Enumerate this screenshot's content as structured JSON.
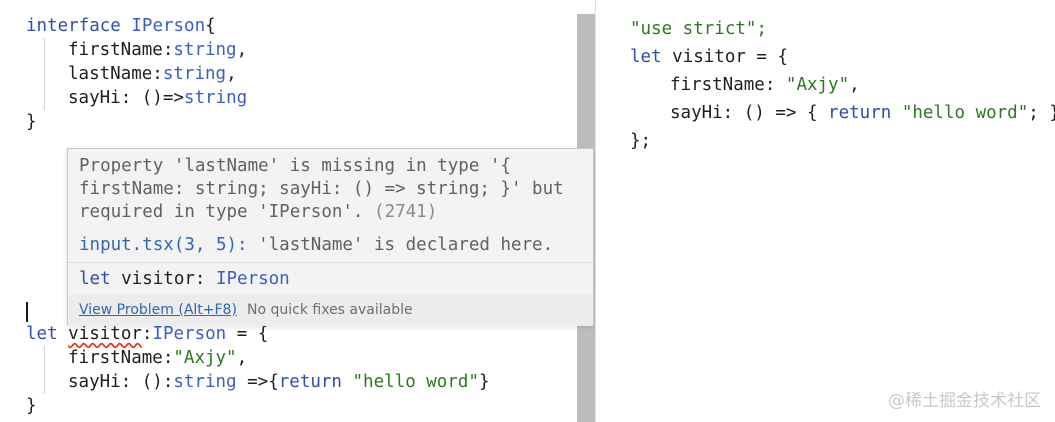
{
  "editor": {
    "interface_block": {
      "kw_interface": "interface",
      "name": "IPerson",
      "open_brace": "{",
      "prop1_name": "firstName",
      "prop1_colon": ":",
      "prop1_type": "string",
      "prop1_comma": ",",
      "prop2_name": "lastName",
      "prop2_colon": ":",
      "prop2_type": "string",
      "prop2_comma": ",",
      "prop3_name": "sayHi",
      "prop3_colon": ": ",
      "prop3_sig": "()=>",
      "prop3_type": "string",
      "close_brace": "}"
    },
    "visitor_block": {
      "kw_let": "let",
      "var_name": "visitor",
      "colon": ":",
      "type_name": "IPerson",
      "assign": " = {",
      "prop1_name": "firstName",
      "prop1_colon": ":",
      "prop1_value": "\"Axjy\"",
      "prop1_comma": ",",
      "prop2_name": "sayHi",
      "prop2_colon": ": ",
      "prop2_paren": "():",
      "prop2_type": "string",
      "prop2_arrow": " =>{",
      "prop2_return": "return",
      "prop2_string": "\"hello word\"",
      "prop2_close": "}",
      "close_brace": "}"
    }
  },
  "hover": {
    "message_line1": "Property 'lastName' is missing in type '{",
    "message_line2": "firstName: string; sayHi: () => string; }' but",
    "message_line3": "required in type 'IPerson'.",
    "error_code": "(2741)",
    "related_link": "input.tsx(3, 5):",
    "related_text": " 'lastName' is declared here.",
    "sig_kw": "let",
    "sig_name": " visitor: ",
    "sig_type": "IPerson",
    "view_problem": "View Problem (Alt+F8)",
    "no_quick_fixes": "No quick fixes available"
  },
  "output": {
    "line1": "\"use strict\";",
    "line2_kw": "let",
    "line2_rest": " visitor = {",
    "line3_name": "firstName: ",
    "line3_value": "\"Axjy\"",
    "line3_comma": ",",
    "line4_name": "sayHi: () => { ",
    "line4_return": "return",
    "line4_space": " ",
    "line4_string": "\"hello word\"",
    "line4_end": "; }",
    "line5": "};"
  },
  "watermark": "@稀土掘金技术社区",
  "colors": {
    "keyword": "#2f4fa8",
    "type": "#3b5ec2",
    "string": "#2b7a1e",
    "error_squiggle": "#e0341e",
    "link": "#2f67b2"
  }
}
